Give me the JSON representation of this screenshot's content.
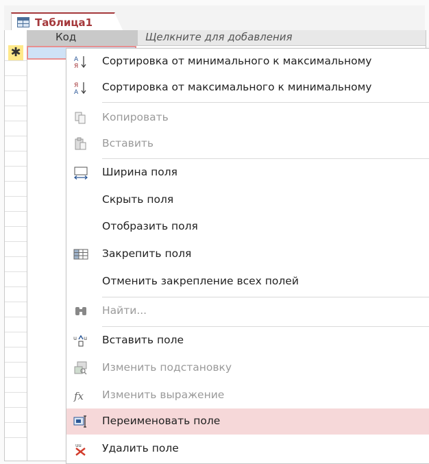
{
  "tab": {
    "title": "Таблица1"
  },
  "header": {
    "col_kod": "Код",
    "col_add": "Щелкните для добавления"
  },
  "new_row_marker": "✱",
  "menu": {
    "items": [
      {
        "name": "sort-asc",
        "label": "Сортировка от минимального к максимальному",
        "icon": "sort-ascending-icon",
        "enabled": true
      },
      {
        "name": "sort-desc",
        "label": "Сортировка от максимального к минимальному",
        "icon": "sort-descending-icon",
        "enabled": true
      },
      {
        "name": "copy",
        "label": "Копировать",
        "icon": "copy-icon",
        "enabled": false
      },
      {
        "name": "paste",
        "label": "Вставить",
        "icon": "paste-icon",
        "enabled": false
      },
      {
        "name": "field-width",
        "label": "Ширина поля",
        "icon": "field-width-icon",
        "enabled": true
      },
      {
        "name": "hide-fields",
        "label": "Скрыть поля",
        "icon": "",
        "enabled": true
      },
      {
        "name": "show-fields",
        "label": "Отобразить поля",
        "icon": "",
        "enabled": true
      },
      {
        "name": "freeze-fields",
        "label": "Закрепить поля",
        "icon": "freeze-icon",
        "enabled": true
      },
      {
        "name": "unfreeze-all",
        "label": "Отменить закрепление всех полей",
        "icon": "",
        "enabled": true
      },
      {
        "name": "find",
        "label": "Найти...",
        "icon": "binoculars-icon",
        "enabled": false
      },
      {
        "name": "insert-field",
        "label": "Вставить поле",
        "icon": "insert-column-icon",
        "enabled": true
      },
      {
        "name": "modify-lookups",
        "label": "Изменить подстановку",
        "icon": "lookup-icon",
        "enabled": false
      },
      {
        "name": "modify-expression",
        "label": "Изменить выражение",
        "icon": "function-icon",
        "enabled": false
      },
      {
        "name": "rename-field",
        "label": "Переименовать поле",
        "icon": "rename-icon",
        "enabled": true,
        "highlighted": true
      },
      {
        "name": "delete-field",
        "label": "Удалить поле",
        "icon": "delete-column-icon",
        "enabled": true
      }
    ]
  },
  "colors": {
    "accent": "#a4373a",
    "highlight": "#f6d8d9",
    "selection": "#cfe2f6"
  }
}
